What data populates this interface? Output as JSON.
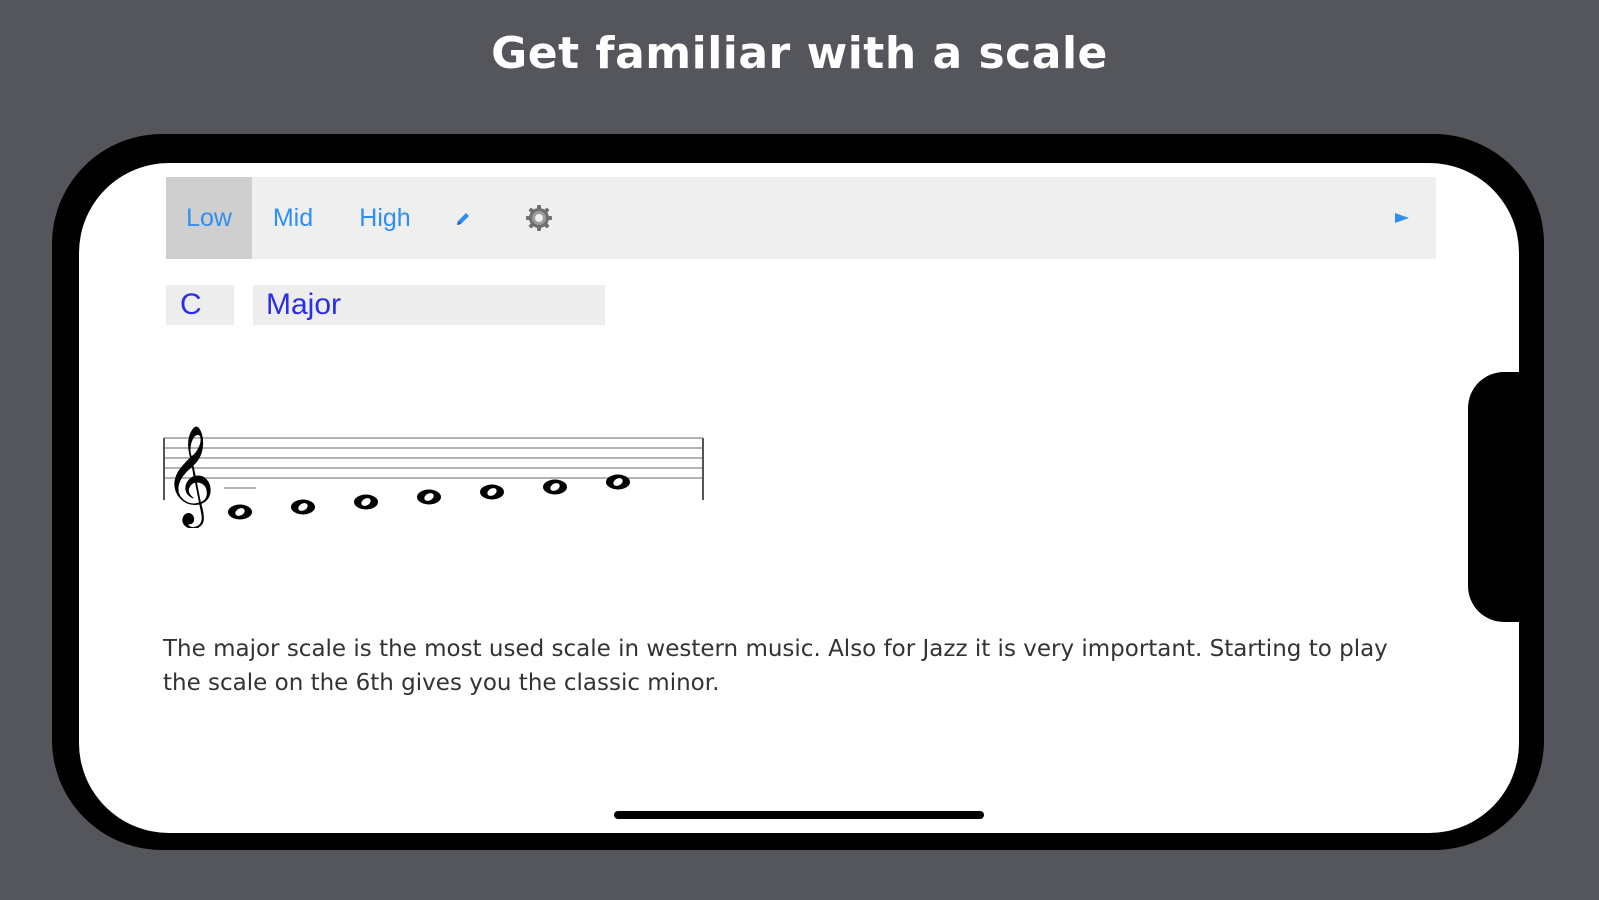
{
  "headline": "Get familiar with a scale",
  "toolbar": {
    "low": "Low",
    "mid": "Mid",
    "high": "High",
    "edit_icon": "pencil-icon",
    "settings_icon": "gear-icon",
    "play_icon": "play-icon",
    "accent_color": "#2f8ef0"
  },
  "key": "C",
  "scale": "Major",
  "staff": {
    "clef": "treble",
    "notes": [
      "C4",
      "D4",
      "E4",
      "F4",
      "G4",
      "A4",
      "B4"
    ]
  },
  "description": "The major scale is the most used scale in western music. Also for Jazz it is very important. Starting to play the scale on the 6th gives you the classic minor."
}
